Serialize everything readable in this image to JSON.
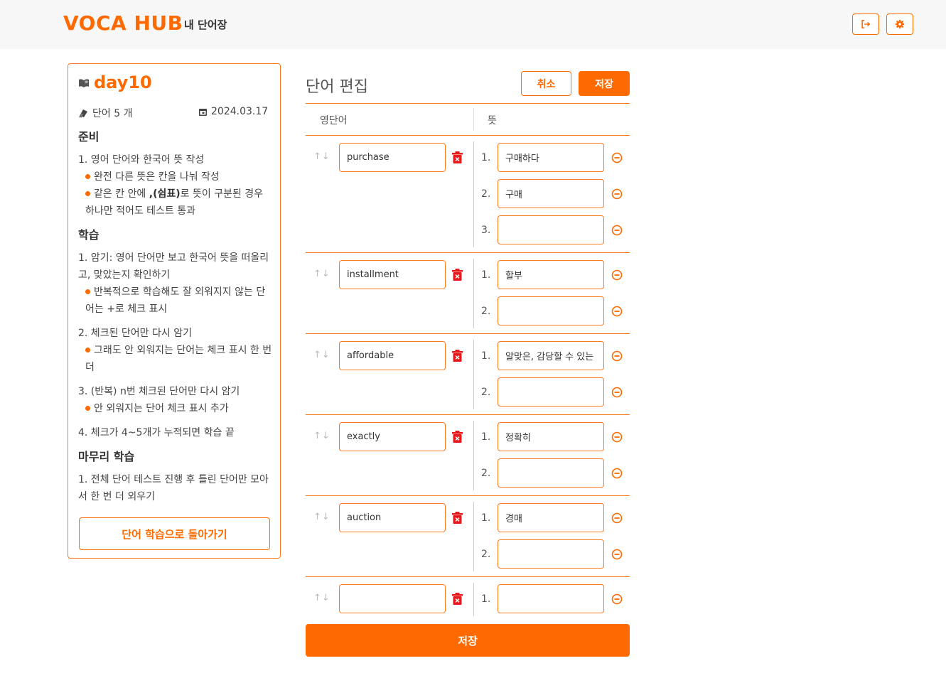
{
  "header": {
    "logo": "VOCA HUB",
    "nav_title": "내 단어장"
  },
  "sidebar": {
    "title": "day10",
    "word_count": "단어 5 개",
    "date": "2024.03.17",
    "guide": {
      "prep_title": "준비",
      "prep_1": "1. 영어 단어와 한국어 뜻 작성",
      "prep_1a": "완전 다른 뜻은 칸을 나눠 작성",
      "prep_1b_pre": "같은 칸 안에 ",
      "prep_1b_bold": ",(쉼표)",
      "prep_1b_post": "로 뜻이 구분된 경우 하나만 적어도 테스트 통과",
      "study_title": "학습",
      "study_1": "1. 암기: 영어 단어만 보고 한국어 뜻을 떠올리고, 맞았는지 확인하기",
      "study_1a": "반복적으로 학습해도 잘 외워지지 않는 단어는 +로 체크 표시",
      "study_2": "2. 체크된 단어만 다시 암기",
      "study_2a": "그래도 안 외워지는 단어는 체크 표시 한 번 더",
      "study_3": "3. (반복) n번 체크된 단어만 다시 암기",
      "study_3a": "안 외워지는 단어 체크 표시 추가",
      "study_4": "4. 체크가 4~5개가 누적되면 학습 끝",
      "finish_title": "마무리 학습",
      "finish_1": "1. 전체 단어 테스트 진행 후 틀린 단어만 모아서 한 번 더 외우기"
    },
    "back_button": "단어 학습으로 돌아가기"
  },
  "editor": {
    "title": "단어 편집",
    "cancel_label": "취소",
    "save_label": "저장",
    "col_word": "영단어",
    "col_meaning": "뜻",
    "arrows": "↑↓",
    "rows": [
      {
        "word": "purchase",
        "meanings": [
          "구매하다",
          "구매",
          ""
        ]
      },
      {
        "word": "installment",
        "meanings": [
          "할부",
          ""
        ]
      },
      {
        "word": "affordable",
        "meanings": [
          "알맞은, 감당할 수 있는",
          ""
        ]
      },
      {
        "word": "exactly",
        "meanings": [
          "정확히",
          ""
        ]
      },
      {
        "word": "auction",
        "meanings": [
          "경매",
          ""
        ]
      },
      {
        "word": "",
        "meanings": [
          ""
        ]
      }
    ],
    "save_bottom_label": "저장"
  },
  "colors": {
    "accent": "#ff6a00",
    "trash": "#e8191a"
  },
  "icons": {
    "logout": "logout-icon",
    "settings": "gear-icon",
    "book": "book-icon",
    "cards": "cards-icon",
    "calendar": "calendar-icon",
    "trash": "trash-icon",
    "minus": "minus-circle-icon"
  }
}
